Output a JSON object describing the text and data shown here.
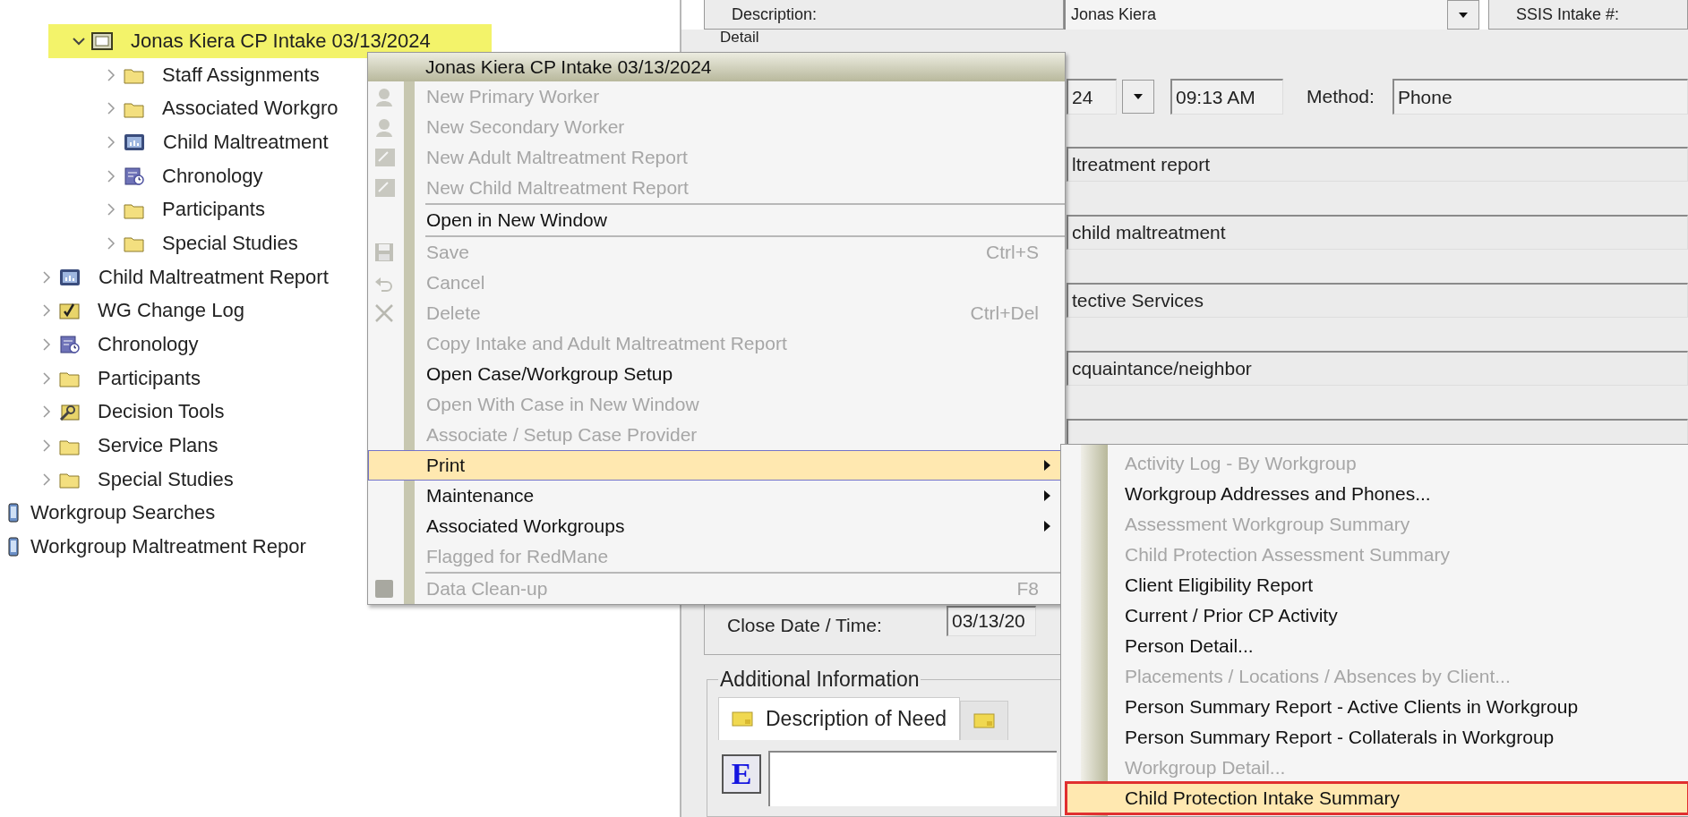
{
  "tree": [
    {
      "children": [
        {
          "children": [
            {
              "label": "Jonas Kiera CP Intake 03/13/2024",
              "kind": "frame",
              "expanded": true,
              "selected": true,
              "children": [
                {
                  "label": "Staff Assignments",
                  "kind": "folder",
                  "expanded": false,
                  "selected": false
                },
                {
                  "label": "Associated Workgro",
                  "kind": "folder",
                  "expanded": false,
                  "selected": false
                },
                {
                  "label": "Child Maltreatment",
                  "kind": "report",
                  "expanded": false,
                  "selected": false
                },
                {
                  "label": "Chronology",
                  "kind": "chronology",
                  "expanded": false,
                  "selected": false
                },
                {
                  "label": "Participants",
                  "kind": "folder",
                  "expanded": false,
                  "selected": false
                },
                {
                  "label": "Special Studies",
                  "kind": "folder",
                  "expanded": false,
                  "selected": false
                }
              ]
            }
          ]
        },
        {
          "label": "Child Maltreatment Report",
          "kind": "report",
          "expanded": false,
          "selected": false
        },
        {
          "label": "WG Change Log",
          "kind": "log",
          "expanded": false,
          "selected": false
        },
        {
          "label": "Chronology",
          "kind": "chronology",
          "expanded": false,
          "selected": false
        },
        {
          "label": "Participants",
          "kind": "folder",
          "expanded": false,
          "selected": false
        },
        {
          "label": "Decision Tools",
          "kind": "tools",
          "expanded": false,
          "selected": false
        },
        {
          "label": "Service Plans",
          "kind": "folder",
          "expanded": false,
          "selected": false
        },
        {
          "label": "Special Studies",
          "kind": "folder",
          "expanded": false,
          "selected": false
        }
      ]
    },
    {
      "label": "Workgroup Searches",
      "kind": "device",
      "selected": false
    },
    {
      "label": "Workgroup Maltreatment Repor",
      "kind": "device",
      "selected": false
    }
  ],
  "detail": {
    "description_label": "Description:",
    "description_value": "Jonas Kiera",
    "ssis_label": "SSIS Intake #:",
    "section_label": "Detail",
    "date_tail": "24",
    "time": "09:13 AM",
    "method_label": "Method:",
    "method_value": "Phone",
    "fields": [
      "ltreatment report",
      "child maltreatment",
      "tective Services",
      "cquaintance/neighbor"
    ],
    "close_date_label": "Close Date / Time:",
    "close_date_value": "03/13/20",
    "additional_info": {
      "title": "Additional Information",
      "tabs": [
        {
          "label": "Description of Need",
          "selected": true
        },
        {
          "selected": false
        }
      ],
      "editor_button": "E"
    }
  },
  "context_menu": {
    "title": "Jonas Kiera CP Intake 03/13/2024",
    "items": [
      {
        "kind": "person",
        "label": "New Primary Worker",
        "disabled": true,
        "selected": false,
        "submenu": false
      },
      {
        "kind": "person",
        "label": "New Secondary Worker",
        "disabled": true,
        "selected": false,
        "submenu": false
      },
      {
        "kind": "document",
        "label": "New Adult Maltreatment Report",
        "disabled": true,
        "selected": false,
        "submenu": false
      },
      {
        "kind": "document",
        "label": "New Child Maltreatment Report",
        "disabled": true,
        "selected": false,
        "submenu": false
      },
      {
        "kind": "separator"
      },
      {
        "kind": "plain",
        "label": "Open in New Window",
        "disabled": false,
        "selected": false,
        "submenu": false
      },
      {
        "kind": "separator"
      },
      {
        "kind": "save",
        "label": "Save",
        "shortcut": "Ctrl+S",
        "disabled": true,
        "selected": false,
        "submenu": false
      },
      {
        "kind": "undo",
        "label": "Cancel",
        "disabled": true,
        "selected": false,
        "submenu": false
      },
      {
        "kind": "delete",
        "label": "Delete",
        "shortcut": "Ctrl+Del",
        "disabled": true,
        "selected": false,
        "submenu": false
      },
      {
        "kind": "plain",
        "label": "Copy Intake and Adult Maltreatment Report",
        "disabled": true,
        "selected": false,
        "submenu": false
      },
      {
        "kind": "plain",
        "label": "Open Case/Workgroup Setup",
        "disabled": false,
        "selected": false,
        "submenu": false
      },
      {
        "kind": "plain",
        "label": "Open With Case in New Window",
        "disabled": true,
        "selected": false,
        "submenu": false
      },
      {
        "kind": "plain",
        "label": "Associate / Setup Case Provider",
        "disabled": true,
        "selected": false,
        "submenu": false
      },
      {
        "kind": "plain",
        "label": "Print",
        "disabled": false,
        "selected": true,
        "submenu": true
      },
      {
        "kind": "plain",
        "label": "Maintenance",
        "disabled": false,
        "selected": false,
        "submenu": true
      },
      {
        "kind": "plain",
        "label": "Associated Workgroups",
        "disabled": false,
        "selected": false,
        "submenu": true
      },
      {
        "kind": "plain",
        "label": "Flagged for RedMane",
        "disabled": true,
        "selected": false,
        "submenu": false
      },
      {
        "kind": "separator"
      },
      {
        "kind": "block",
        "label": "Data Clean-up",
        "shortcut": "F8",
        "disabled": true,
        "selected": false,
        "submenu": false
      }
    ]
  },
  "print_submenu": {
    "items": [
      {
        "label": "Activity Log - By Workgroup",
        "disabled": true,
        "selected": false,
        "outlined": false
      },
      {
        "label": "Workgroup Addresses and Phones...",
        "disabled": false,
        "selected": false,
        "outlined": false
      },
      {
        "label": "Assessment Workgroup Summary",
        "disabled": true,
        "selected": false,
        "outlined": false
      },
      {
        "label": "Child Protection Assessment Summary",
        "disabled": true,
        "selected": false,
        "outlined": false
      },
      {
        "label": "Client Eligibility Report",
        "disabled": false,
        "selected": false,
        "outlined": false
      },
      {
        "label": "Current / Prior CP Activity",
        "disabled": false,
        "selected": false,
        "outlined": false
      },
      {
        "label": "Person Detail...",
        "disabled": false,
        "selected": false,
        "outlined": false
      },
      {
        "label": "Placements / Locations / Absences by Client...",
        "disabled": true,
        "selected": false,
        "outlined": false
      },
      {
        "label": "Person Summary Report - Active Clients in Workgroup",
        "disabled": false,
        "selected": false,
        "outlined": false
      },
      {
        "label": "Person Summary Report - Collaterals in Workgroup",
        "disabled": false,
        "selected": false,
        "outlined": false
      },
      {
        "label": "Workgroup Detail...",
        "disabled": true,
        "selected": false,
        "outlined": false
      },
      {
        "label": "Child Protection Intake Summary",
        "disabled": false,
        "selected": true,
        "outlined": true
      }
    ]
  }
}
